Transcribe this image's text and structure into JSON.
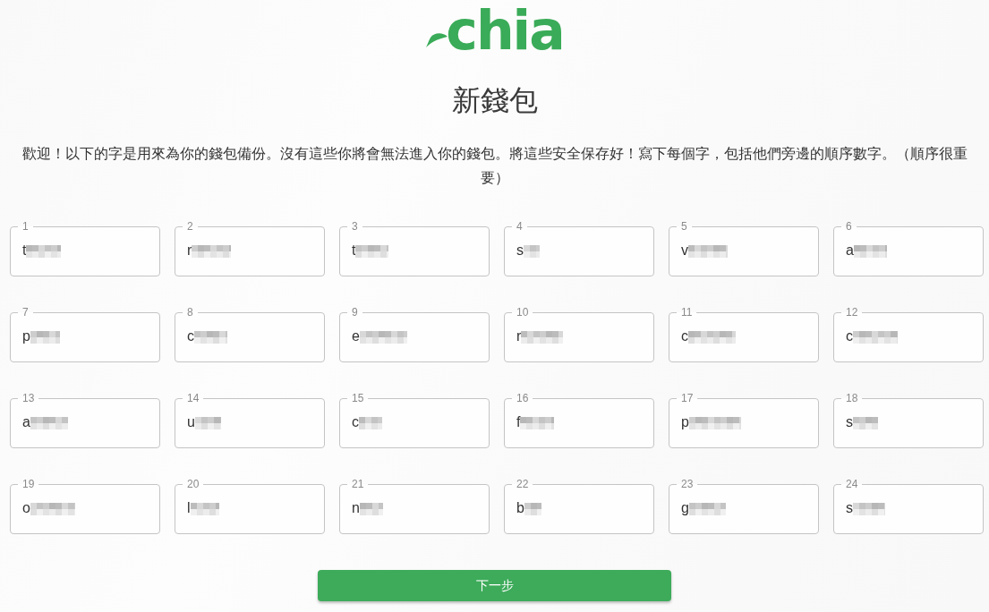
{
  "logo": {
    "text": "chia"
  },
  "title": "新錢包",
  "instructions": "歡迎！以下的字是用來為你的錢包備份。沒有這些你將會無法進入你的錢包。將這些安全保存好！寫下每個字，包括他們旁邊的順序數字。（順序很重要）",
  "words": [
    {
      "number": "1",
      "value": "t",
      "redacted": true
    },
    {
      "number": "2",
      "value": "r",
      "redacted": true
    },
    {
      "number": "3",
      "value": "t",
      "redacted": true
    },
    {
      "number": "4",
      "value": "s",
      "redacted": true
    },
    {
      "number": "5",
      "value": "v",
      "redacted": true
    },
    {
      "number": "6",
      "value": "a",
      "redacted": true
    },
    {
      "number": "7",
      "value": "p",
      "redacted": true
    },
    {
      "number": "8",
      "value": "c",
      "redacted": true
    },
    {
      "number": "9",
      "value": "e",
      "redacted": true
    },
    {
      "number": "10",
      "value": "r",
      "redacted": true
    },
    {
      "number": "11",
      "value": "c",
      "redacted": true
    },
    {
      "number": "12",
      "value": "c",
      "redacted": true
    },
    {
      "number": "13",
      "value": "a",
      "redacted": true
    },
    {
      "number": "14",
      "value": "u",
      "redacted": true
    },
    {
      "number": "15",
      "value": "c",
      "redacted": true
    },
    {
      "number": "16",
      "value": "f",
      "redacted": true
    },
    {
      "number": "17",
      "value": "p",
      "redacted": true
    },
    {
      "number": "18",
      "value": "s",
      "redacted": true
    },
    {
      "number": "19",
      "value": "o",
      "redacted": true
    },
    {
      "number": "20",
      "value": "l",
      "redacted": true
    },
    {
      "number": "21",
      "value": "n",
      "redacted": true
    },
    {
      "number": "22",
      "value": "b",
      "redacted": true
    },
    {
      "number": "23",
      "value": "g",
      "redacted": true
    },
    {
      "number": "24",
      "value": "s",
      "redacted": true
    }
  ],
  "next_button": {
    "label": "下一步"
  }
}
